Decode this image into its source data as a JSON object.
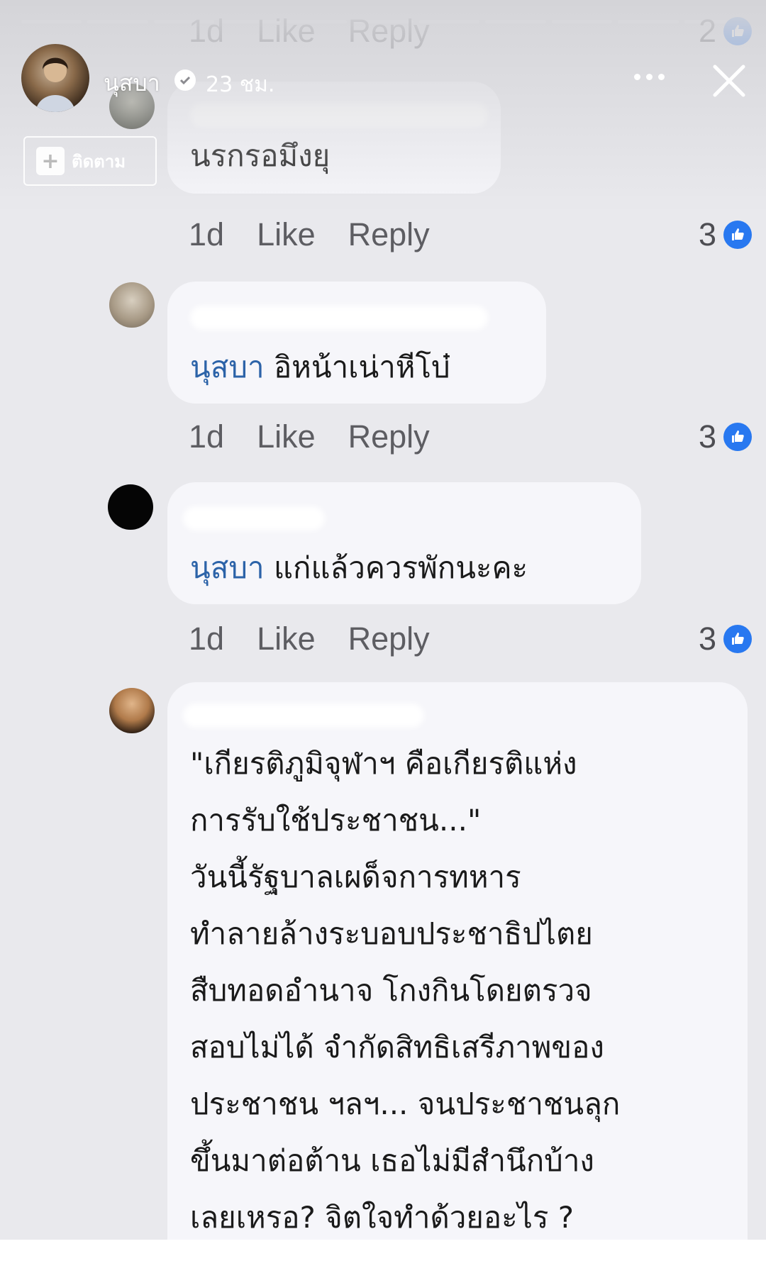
{
  "story": {
    "user_name": "นุสบา",
    "time_ago": "23 ชม.",
    "follow_label": "ติดตาม"
  },
  "comments": [
    {
      "partial_meta": {
        "age": "1d",
        "like": "Like",
        "reply": "Reply",
        "likes": "2"
      }
    },
    {
      "text": "นรกรอมึงยุ",
      "meta": {
        "age": "1d",
        "like": "Like",
        "reply": "Reply",
        "likes": "3"
      }
    },
    {
      "mention": "นุสบา",
      "text": " อิหน้าเน่าหีโบ๋",
      "meta": {
        "age": "1d",
        "like": "Like",
        "reply": "Reply",
        "likes": "3"
      }
    },
    {
      "mention": "นุสบา",
      "text": " แก่แล้วควรพักนะคะ",
      "meta": {
        "age": "1d",
        "like": "Like",
        "reply": "Reply",
        "likes": "3"
      }
    },
    {
      "lines": [
        "\"เกียรติภูมิจุฬาฯ คือเกียรติแห่ง",
        "การรับใช้ประชาชน...\"",
        "วันนี้รัฐบาลเผด็จการทหาร",
        "ทำลายล้างระบอบประชาธิปไตย",
        "สืบทอดอำนาจ โกงกินโดยตรวจ",
        "สอบไม่ได้ จำกัดสิทธิเสรีภาพของ",
        "ประชาชน ฯลฯ... จนประชาชนลุก",
        "ขึ้นมาต่อต้าน เธอไม่มีสำนึกบ้าง",
        "เลยเหรอ? จิตใจทำด้วยอะไร ?"
      ]
    }
  ],
  "colors": {
    "mention": "#2c63a8",
    "like_icon": "#2878f0",
    "bubble": "#f6f6fa",
    "background": "#e9e9ed"
  }
}
